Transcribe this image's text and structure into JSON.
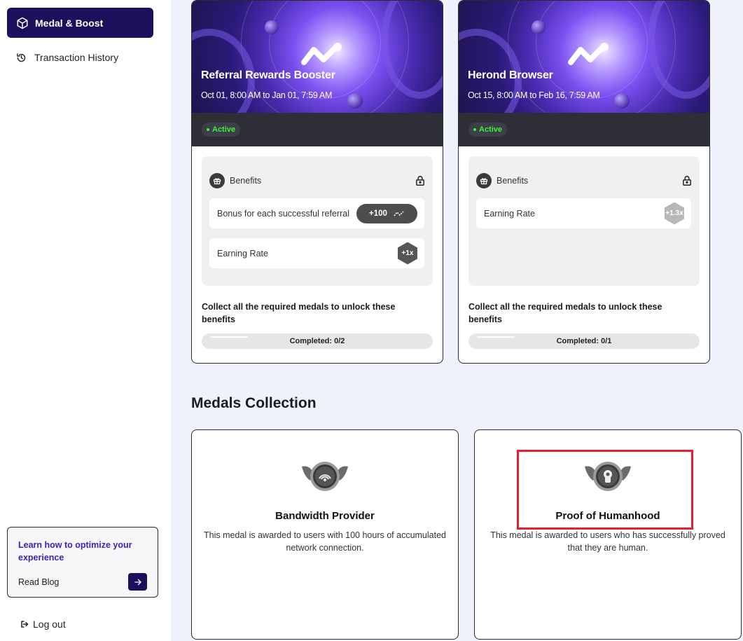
{
  "sidebar": {
    "items": [
      {
        "label": "Medal & Boost",
        "icon": "cube-icon",
        "active": true
      },
      {
        "label": "Transaction History",
        "icon": "history-icon",
        "active": false
      }
    ],
    "promo": {
      "title": "Learn how to optimize your experience",
      "link_label": "Read Blog"
    },
    "logout_label": "Log out"
  },
  "boosts": [
    {
      "title": "Referral Rewards Booster",
      "date_range": "Oct 01, 8:00 AM to Jan 01, 7:59 AM",
      "status": "Active",
      "benefits_label": "Benefits",
      "benefits": [
        {
          "label": "Bonus for each successful referral",
          "badge": "+100",
          "badge_type": "points-pill"
        },
        {
          "label": "Earning Rate",
          "badge": "+1x",
          "badge_type": "hex-dark"
        }
      ],
      "collect_text": "Collect all the required medals to unlock these benefits",
      "progress_label": "Completed: 0/2"
    },
    {
      "title": "Herond Browser",
      "date_range": "Oct 15, 8:00 AM to Feb 16, 7:59 AM",
      "status": "Active",
      "benefits_label": "Benefits",
      "benefits": [
        {
          "label": "Earning Rate",
          "badge": "+1.3x",
          "badge_type": "hex-light"
        }
      ],
      "collect_text": "Collect all the required medals to unlock these benefits",
      "progress_label": "Completed: 0/1"
    }
  ],
  "medals_section": {
    "title": "Medals Collection",
    "medals": [
      {
        "name": "Bandwidth Provider",
        "description": "This medal is awarded to users with 100 hours of accumulated network connection.",
        "icon": "bandwidth-medal-icon"
      },
      {
        "name": "Proof of Humanhood",
        "description": "This medal is awarded to users who has successfully proved that they are human.",
        "icon": "humanhood-medal-icon"
      }
    ]
  },
  "colors": {
    "sidebar_active": "#1c0f5c",
    "promo_title": "#3a24b8",
    "status_green": "#3cf23c",
    "main_bg": "#eff1fd",
    "highlight": "#e8202a"
  }
}
